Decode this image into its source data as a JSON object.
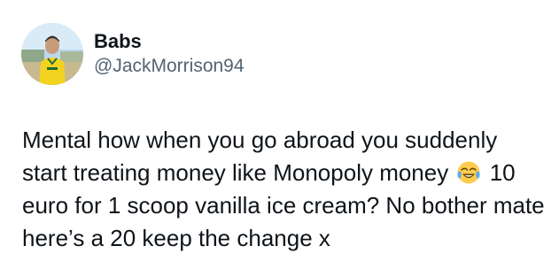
{
  "tweet": {
    "author": {
      "display_name": "Babs",
      "handle": "@JackMorrison94",
      "avatar_icon": "profile-photo-avatar"
    },
    "text_part1": "Mental how when you go abroad you suddenly start treating money like Monopoly money",
    "emoji": "face-with-tears-of-joy-emoji",
    "text_part2": "10 euro for 1 scoop vanilla ice cream? No bother mate here’s a 20 keep the change x"
  }
}
